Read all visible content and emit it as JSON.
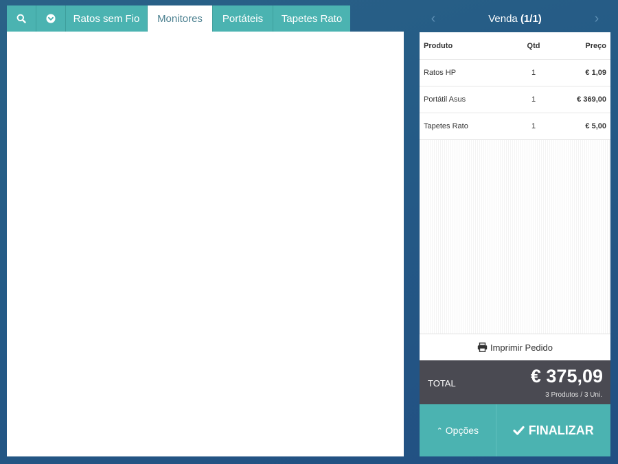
{
  "tabs": {
    "search_icon": "search-icon",
    "dropdown_icon": "chevron-circle-down-icon",
    "items": [
      {
        "label": "Ratos sem Fio"
      },
      {
        "label": "Monitores"
      },
      {
        "label": "Portáteis"
      },
      {
        "label": "Tapetes Rato"
      }
    ],
    "active": "Monitores"
  },
  "sale": {
    "title_prefix": "Venda",
    "counter": "(1/1)",
    "prev_icon": "chevron-left-icon",
    "next_icon": "chevron-right-icon"
  },
  "order": {
    "columns": {
      "product": "Produto",
      "qty": "Qtd",
      "price": "Preço"
    },
    "rows": [
      {
        "product": "Ratos HP",
        "qty": "1",
        "price": "€ 1,09"
      },
      {
        "product": "Portátil Asus",
        "qty": "1",
        "price": "€ 369,00"
      },
      {
        "product": "Tapetes Rato",
        "qty": "1",
        "price": "€ 5,00"
      }
    ],
    "remove_icon": "times-icon",
    "print_label": "Imprimir Pedido",
    "print_icon": "printer-icon"
  },
  "total": {
    "label": "TOTAL",
    "value": "€ 375,09",
    "summary": "3 Produtos / 3 Uni."
  },
  "actions": {
    "options_label": "Opções",
    "options_icon": "chevron-up-icon",
    "finalize_label": "FINALIZAR",
    "finalize_icon": "check-icon"
  },
  "colors": {
    "accent": "#4bb3b1",
    "background": "#255a86",
    "total_bg": "#4a4a52",
    "remove": "#b08a78"
  }
}
